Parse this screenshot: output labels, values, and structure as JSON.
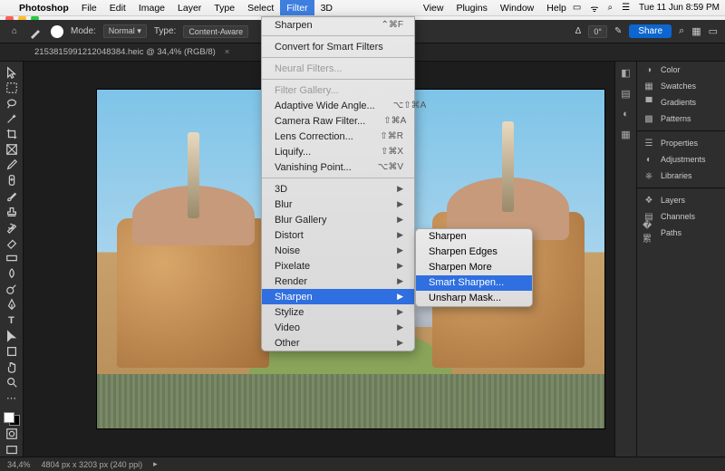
{
  "menubar": {
    "app": "Photoshop",
    "items": [
      "File",
      "Edit",
      "Image",
      "Layer",
      "Type",
      "Select",
      "Filter",
      "3D"
    ],
    "items_right": [
      "View",
      "Plugins",
      "Window",
      "Help"
    ],
    "active": "Filter",
    "clock": "Tue 11 Jun  8:59 PM"
  },
  "options_bar": {
    "mode_label": "Mode:",
    "mode_value": "Normal",
    "type_label": "Type:",
    "type_value": "Content-Aware",
    "angle_label": "Δ",
    "angle_value": "0°",
    "share": "Share"
  },
  "document": {
    "tab": "215381599121204838​4.heic @ 34,4% (RGB/8)",
    "zoom": "34,4%",
    "dims": "4804 px x 3203 px (240 ppi)"
  },
  "right_panels": {
    "g1": [
      "Color",
      "Swatches",
      "Gradients",
      "Patterns"
    ],
    "g2": [
      "Properties",
      "Adjustments",
      "Libraries"
    ],
    "g3": [
      "Layers",
      "Channels",
      "Paths"
    ]
  },
  "filter_menu": {
    "last": "Sharpen",
    "last_sc": "⌃⌘F",
    "convert": "Convert for Smart Filters",
    "neural": "Neural Filters...",
    "gallery": "Filter Gallery...",
    "adaptive": "Adaptive Wide Angle...",
    "adaptive_sc": "⌥⇧⌘A",
    "camera": "Camera Raw Filter...",
    "camera_sc": "⇧⌘A",
    "lens": "Lens Correction...",
    "lens_sc": "⇧⌘R",
    "liquify": "Liquify...",
    "liquify_sc": "⇧⌘X",
    "vanish": "Vanishing Point...",
    "vanish_sc": "⌥⌘V",
    "subs": [
      "3D",
      "Blur",
      "Blur Gallery",
      "Distort",
      "Noise",
      "Pixelate",
      "Render",
      "Sharpen",
      "Stylize",
      "Video",
      "Other"
    ]
  },
  "sharpen_sub": {
    "items": [
      "Sharpen",
      "Sharpen Edges",
      "Sharpen More",
      "Smart Sharpen...",
      "Unsharp Mask..."
    ],
    "highlight": "Smart Sharpen..."
  }
}
